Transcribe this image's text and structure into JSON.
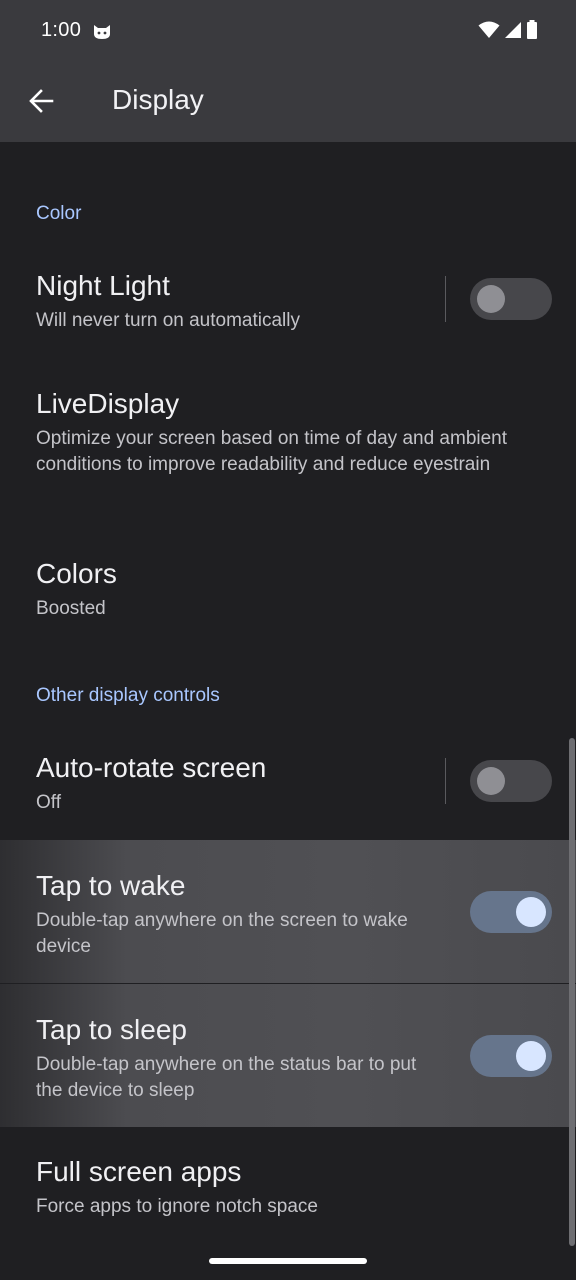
{
  "status_bar": {
    "time": "1:00",
    "icons": [
      "cat-notification-icon",
      "wifi-icon",
      "cell-signal-icon",
      "battery-icon"
    ]
  },
  "app_bar": {
    "back_icon": "back-arrow-icon",
    "title": "Display"
  },
  "sections": {
    "color": {
      "header": "Color"
    },
    "other": {
      "header": "Other display controls"
    }
  },
  "items": {
    "night_light": {
      "title": "Night Light",
      "summary": "Will never turn on automatically",
      "switch": "off"
    },
    "live_display": {
      "title": "LiveDisplay",
      "summary": "Optimize your screen based on time of day and ambient conditions to improve readability and reduce eyestrain"
    },
    "colors": {
      "title": "Colors",
      "summary": "Boosted"
    },
    "auto_rotate": {
      "title": "Auto-rotate screen",
      "summary": "Off",
      "switch": "off"
    },
    "tap_to_wake": {
      "title": "Tap to wake",
      "summary": "Double-tap anywhere on the screen to wake device",
      "switch": "on"
    },
    "tap_to_sleep": {
      "title": "Tap to sleep",
      "summary": "Double-tap anywhere on the status bar to put the device to sleep",
      "switch": "on"
    },
    "full_screen_apps": {
      "title": "Full screen apps",
      "summary": "Force apps to ignore notch space"
    }
  },
  "colors": {
    "accent": "#a9c7ff",
    "background": "#1f1f22",
    "app_bar": "#3a3a3e",
    "switch_on_track": "#66758c",
    "switch_on_thumb": "#d8e6ff"
  }
}
